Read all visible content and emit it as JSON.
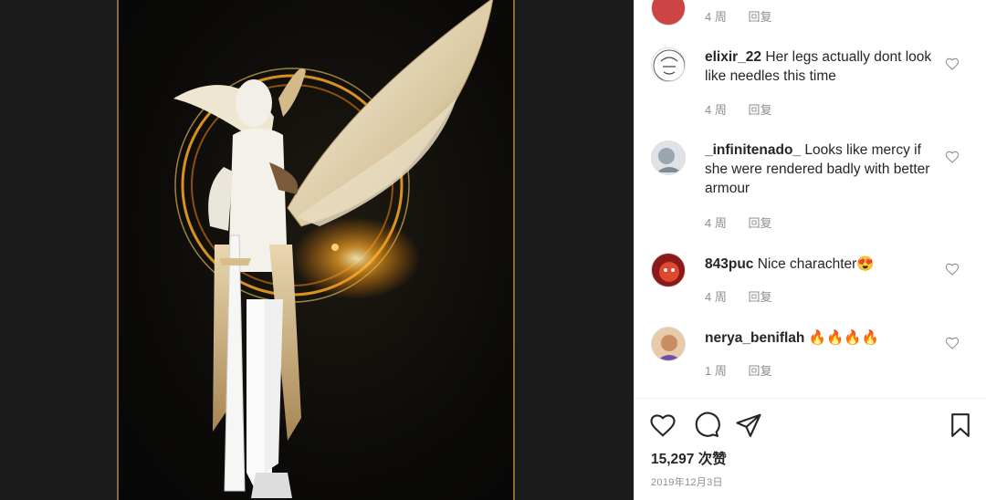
{
  "post": {
    "image_alt": "Winged white-armored warrior artwork"
  },
  "comments": [
    {
      "user": "",
      "text": "",
      "age": "4 周",
      "reply": "回复",
      "avatar_color": "#c44"
    },
    {
      "user": "elixir_22",
      "text": "Her legs actually dont look like needles this time",
      "age": "4 周",
      "reply": "回复",
      "avatar_color": "#eee"
    },
    {
      "user": "_infinitenado_",
      "text": "Looks like mercy if she were rendered badly with better armour",
      "age": "4 周",
      "reply": "回复",
      "avatar_color": "#dfe3e8"
    },
    {
      "user": "843puc",
      "text": "Nice charachter😍",
      "age": "4 周",
      "reply": "回复",
      "avatar_color": "#b22"
    },
    {
      "user": "nerya_beniflah",
      "text": "🔥🔥🔥🔥",
      "age": "1 周",
      "reply": "回复",
      "avatar_color": "#d9a77f"
    }
  ],
  "actions": {
    "likes": "15,297 次赞",
    "date": "2019年12月3日"
  },
  "icons": [
    "heart-icon",
    "comment-icon",
    "share-icon",
    "bookmark-icon"
  ],
  "colors": {
    "text": "#262626",
    "muted": "#8e8e8e",
    "frame_gold": "#8a6a32"
  }
}
